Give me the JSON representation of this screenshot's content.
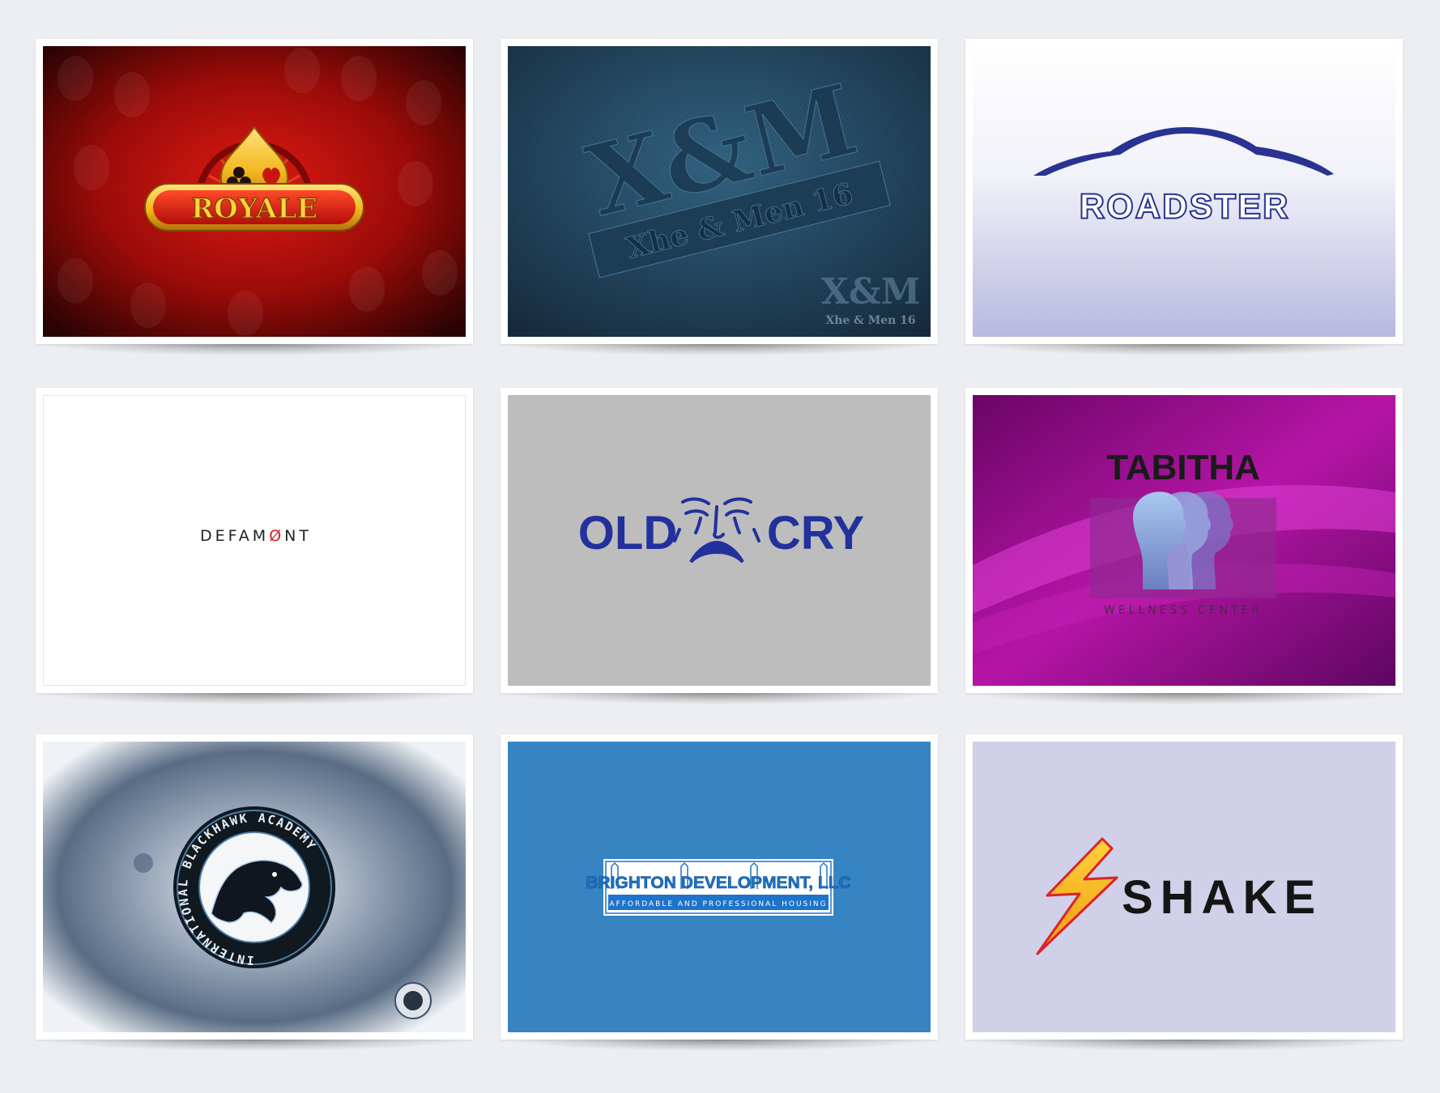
{
  "logos": {
    "royale": {
      "name": "ROYALE",
      "colors": {
        "bg_center": "#d8140f",
        "bg_edge": "#2a0303",
        "gold": "#f2b81f"
      }
    },
    "xm": {
      "monogram": "X&M",
      "banner": "Xhe & Men 16",
      "stamp_monogram": "X&M",
      "stamp_text": "Xhe & Men 16",
      "colors": {
        "bg": "#284f69"
      }
    },
    "roadster": {
      "name": "ROADSTER",
      "colors": {
        "primary": "#2a3391",
        "bg_bottom": "#b8b9df"
      }
    },
    "defamont": {
      "prefix": "DEFAM",
      "slash_letter": "Ø",
      "suffix": "NT",
      "colors": {
        "accent": "#d42020"
      }
    },
    "oldcry": {
      "left": "OLD",
      "right": "CRY",
      "colors": {
        "primary": "#23319c",
        "bg": "#bdbdbd"
      }
    },
    "tabitha": {
      "name": "TABITHA",
      "tagline": "WELLNESS CENTER",
      "colors": {
        "bg": "#9a0c8e",
        "heads": "#8db3e0"
      }
    },
    "blackhawk": {
      "ring_text": "INTERNATIONAL BLACKHAWK ACADEMY",
      "colors": {
        "ring": "#101820",
        "wash": "#3b526e"
      }
    },
    "brighton": {
      "name": "BRIGHTON DEVELOPMENT, LLC",
      "tagline": "AFFORDABLE AND PROFESSIONAL HOUSING",
      "colors": {
        "bg": "#3684c2",
        "blue": "#1f73c9"
      }
    },
    "shake": {
      "name": "SHAKE",
      "colors": {
        "bolt": "#f6b51a",
        "bolt_edge": "#d9232a",
        "bg": "#d0d0e8"
      }
    }
  }
}
